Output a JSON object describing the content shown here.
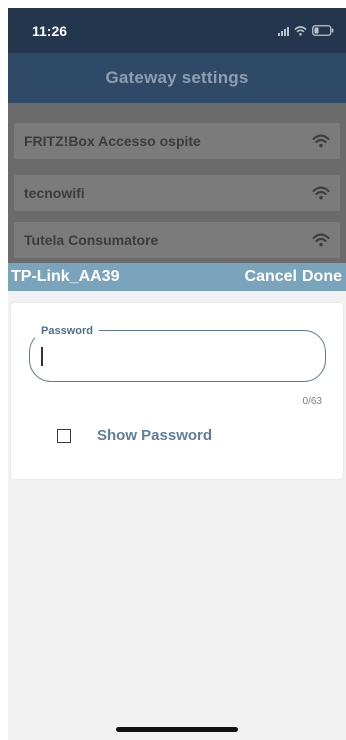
{
  "status_bar": {
    "time": "11:26",
    "signal_icon": "signal-icon",
    "wifi_icon": "wifi-icon",
    "battery_icon": "battery-icon"
  },
  "header": {
    "title": "Gateway settings"
  },
  "networks": [
    {
      "name": "FRITZ!Box Accesso ospite",
      "icon": "wifi-icon"
    },
    {
      "name": "tecnowifi",
      "icon": "wifi-icon"
    },
    {
      "name": "Tutela Consumatore",
      "icon": "wifi-icon"
    }
  ],
  "dialog": {
    "ssid": "TP-Link_AA39",
    "cancel_label": "Cancel",
    "done_label": "Done",
    "password_label": "Password",
    "password_value": "",
    "counter": "0/63",
    "show_password_label": "Show Password",
    "show_password_checked": false
  },
  "colors": {
    "header_bg": "#2f4a66",
    "status_bg": "#23364d",
    "picker_bar_bg": "#7aa4bc",
    "accent": "#5e7e99"
  }
}
